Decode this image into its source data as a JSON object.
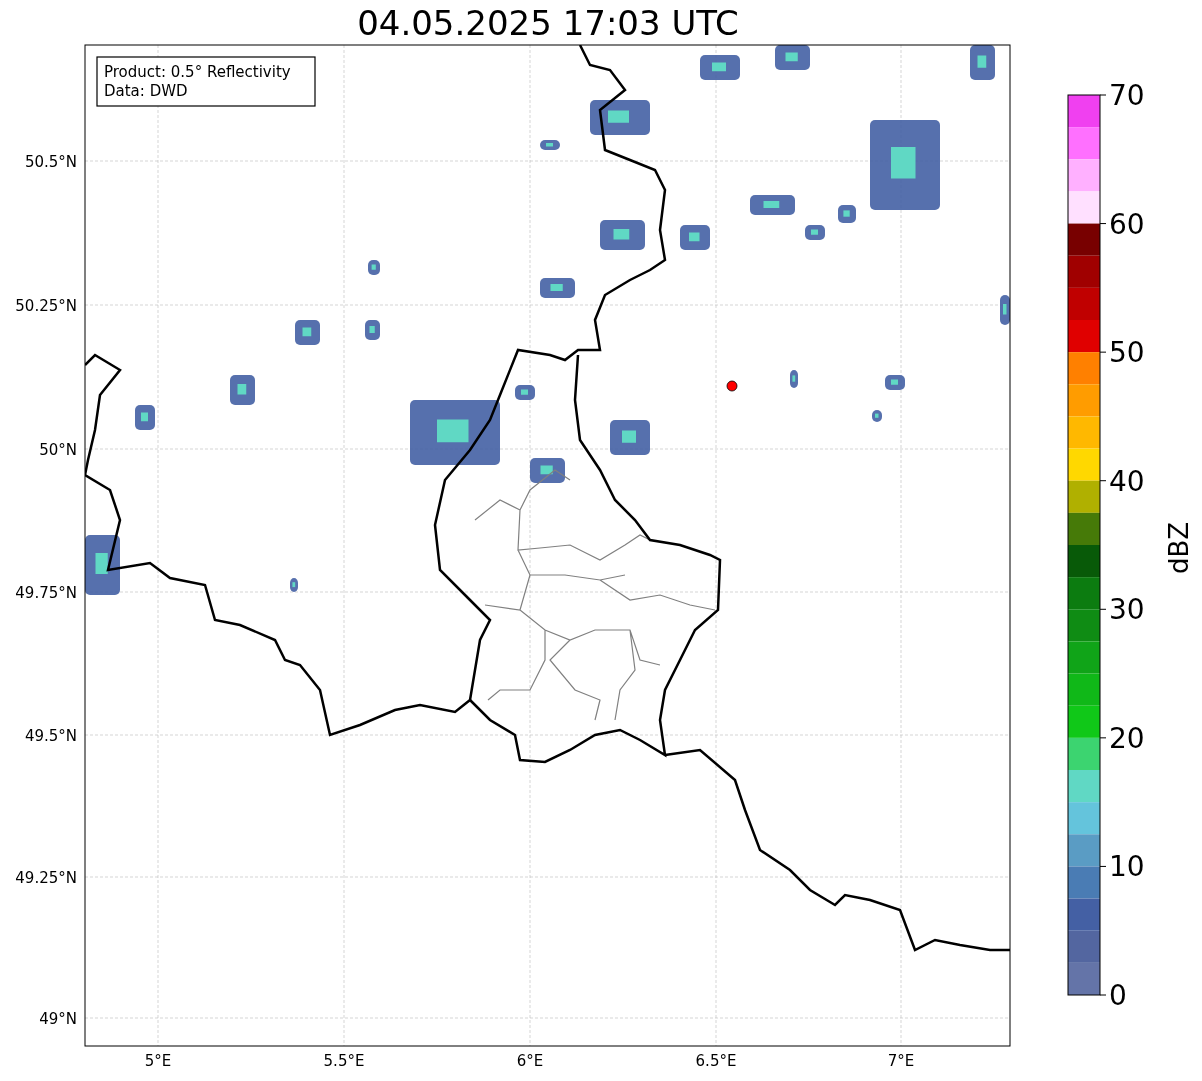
{
  "title": "04.05.2025 17:03 UTC",
  "info_box": [
    "Product: 0.5° Reflectivity",
    "Data: DWD"
  ],
  "map": {
    "lat_ticks": [
      "50.5°N",
      "50.25°N",
      "50°N",
      "49.75°N",
      "49.5°N",
      "49.25°N",
      "49°N"
    ],
    "lon_ticks": [
      "5°E",
      "5.5°E",
      "6°E",
      "6.5°E",
      "7°E"
    ]
  },
  "colorbar": {
    "label": "dBZ",
    "ticks": [
      "70",
      "60",
      "50",
      "40",
      "30",
      "20",
      "10",
      "0"
    ],
    "bins": [
      {
        "color": "#f040f0"
      },
      {
        "color": "#ff70ff"
      },
      {
        "color": "#ffb0ff"
      },
      {
        "color": "#ffe0ff"
      },
      {
        "color": "#780000"
      },
      {
        "color": "#a00000"
      },
      {
        "color": "#c00000"
      },
      {
        "color": "#e00000"
      },
      {
        "color": "#ff8000"
      },
      {
        "color": "#ff9c00"
      },
      {
        "color": "#ffb800"
      },
      {
        "color": "#ffd800"
      },
      {
        "color": "#b0b000"
      },
      {
        "color": "#467a08"
      },
      {
        "color": "#085a08"
      },
      {
        "color": "#0c7c10"
      },
      {
        "color": "#0f8c14"
      },
      {
        "color": "#10a418"
      },
      {
        "color": "#10b818"
      },
      {
        "color": "#10c818"
      },
      {
        "color": "#3cd470"
      },
      {
        "color": "#60d8c4"
      },
      {
        "color": "#64c4dc"
      },
      {
        "color": "#5a9cc4"
      },
      {
        "color": "#4a7cb4"
      },
      {
        "color": "#4460a4"
      },
      {
        "color": "#5366a0"
      },
      {
        "color": "#6474a8"
      }
    ]
  }
}
